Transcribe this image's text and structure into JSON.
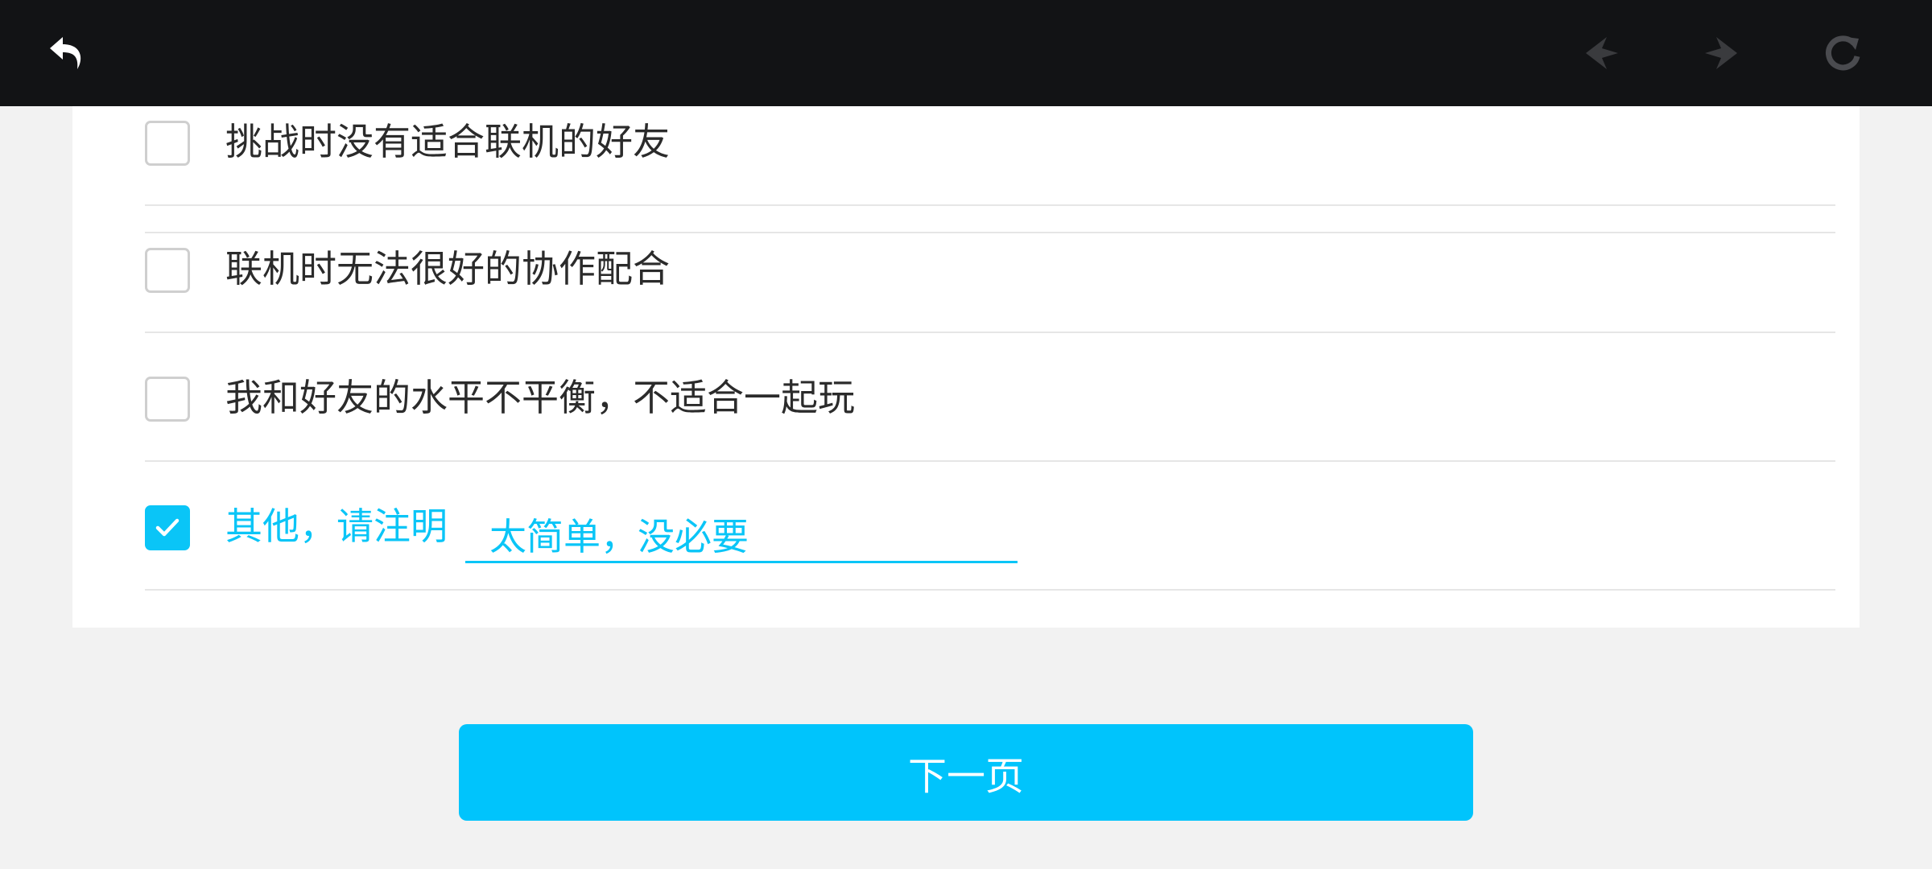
{
  "toolbar": {
    "back_icon": "back-arrow-icon",
    "prev_icon": "prev-page-icon",
    "next_icon": "next-page-icon",
    "refresh_icon": "refresh-icon"
  },
  "options": [
    {
      "label": "挑战时没有适合联机的好友",
      "checked": false
    },
    {
      "label": "联机时无法很好的协作配合",
      "checked": false
    },
    {
      "label": "我和好友的水平不平衡，不适合一起玩",
      "checked": false
    },
    {
      "label": "其他，请注明",
      "checked": true,
      "input_value": "太简单，没必要"
    }
  ],
  "next_button": {
    "label": "下一页"
  },
  "colors": {
    "accent": "#0ac5f7",
    "button": "#00c4fc",
    "topbar": "#121315",
    "background": "#f2f2f2"
  }
}
